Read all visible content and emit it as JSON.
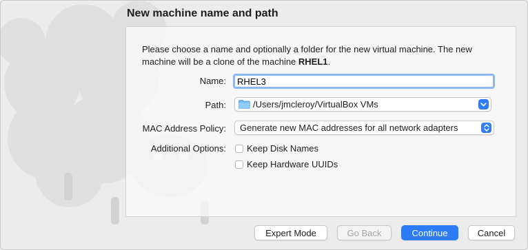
{
  "title": "New machine name and path",
  "description": {
    "line1": "Please choose a name and optionally a folder for the new virtual machine. The new",
    "line2_prefix": "machine will be a clone of the machine ",
    "line2_machine": "RHEL1",
    "line2_suffix": "."
  },
  "form": {
    "name_label": "Name:",
    "name_value": "RHEL3",
    "path_label": "Path:",
    "path_value": "/Users/jmcleroy/VirtualBox VMs",
    "mac_label": "MAC Address Policy:",
    "mac_value": "Generate new MAC addresses for all network adapters",
    "options_label": "Additional Options:",
    "keep_disk_names": "Keep Disk Names",
    "keep_hardware_uuids": "Keep Hardware UUIDs"
  },
  "buttons": {
    "expert_mode": "Expert Mode",
    "go_back": "Go Back",
    "continue": "Continue",
    "cancel": "Cancel"
  },
  "colors": {
    "accent": "#2d7cf6",
    "focus_ring": "#8ab8f4"
  }
}
